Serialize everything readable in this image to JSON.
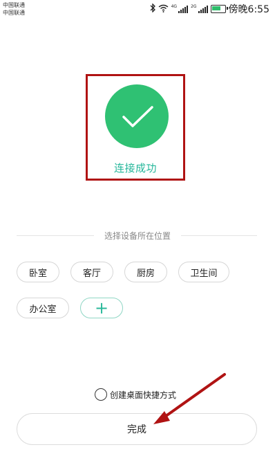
{
  "status_bar": {
    "carrier1": "中国联通",
    "carrier2": "中国联通",
    "net1": "4G",
    "net2": "2G",
    "time": "傍晚6:55",
    "battery_level": 0.8,
    "icons": [
      "bluetooth-icon",
      "wifi-icon",
      "signal-icon",
      "battery-icon"
    ]
  },
  "success": {
    "text": "连接成功",
    "icon": "check-icon",
    "circle_color": "#2fc173",
    "text_color": "#26b79b"
  },
  "location": {
    "title": "选择设备所在位置",
    "rooms": [
      "卧室",
      "客厅",
      "厨房",
      "卫生间",
      "办公室"
    ],
    "add_label": "+"
  },
  "shortcut": {
    "label": "创建桌面快捷方式",
    "checked": false
  },
  "done_button": {
    "label": "完成"
  },
  "annotations": {
    "highlight_color": "#b01313"
  }
}
